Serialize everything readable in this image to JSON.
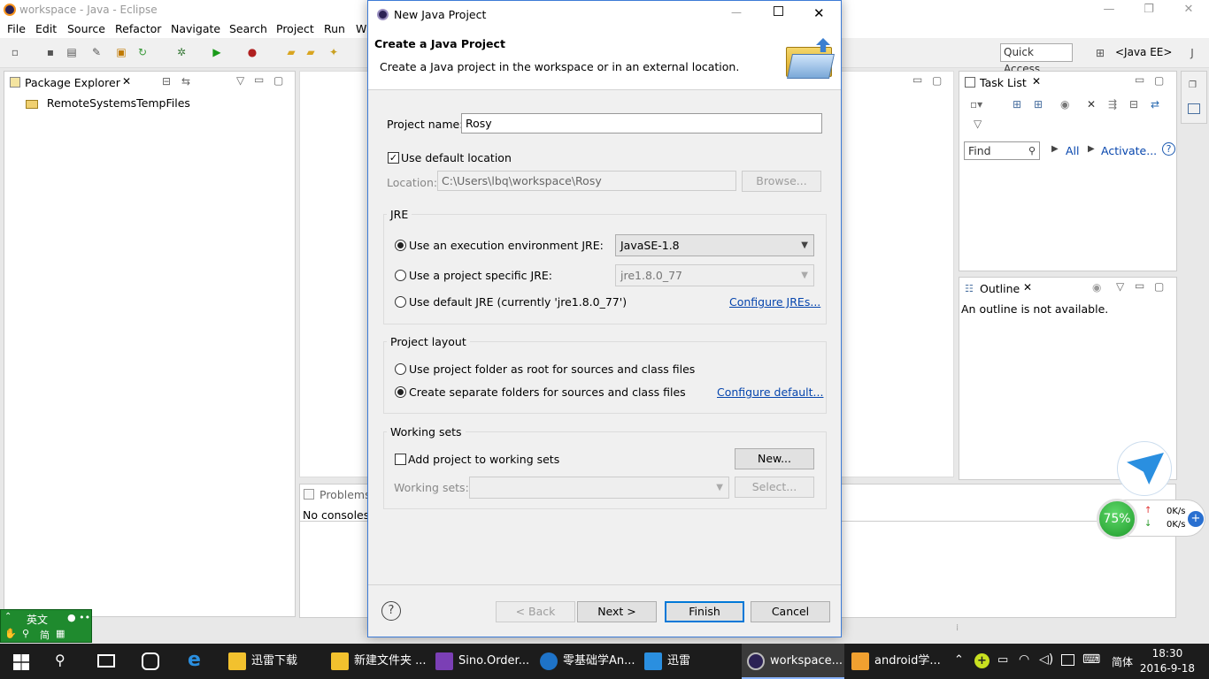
{
  "eclipse": {
    "window_title": "workspace - Java - Eclipse",
    "menu": [
      "File",
      "Edit",
      "Source",
      "Refactor",
      "Navigate",
      "Search",
      "Project",
      "Run",
      "W"
    ],
    "quick_access": "Quick Access",
    "perspective": "<Java EE>",
    "package_explorer": {
      "tab": "Package Explorer",
      "items": [
        "RemoteSystemsTempFiles"
      ]
    },
    "console": {
      "tab": "Problems",
      "message": "No consoles"
    },
    "task_list": {
      "tab": "Task List",
      "find_placeholder": "Find",
      "all": "All",
      "activate": "Activate..."
    },
    "outline": {
      "tab": "Outline",
      "message": "An outline is not available."
    }
  },
  "dialog": {
    "title": "New Java Project",
    "header_title": "Create a Java Project",
    "header_desc": "Create a Java project in the workspace or in an external location.",
    "project_name_label": "Project name:",
    "project_name_value": "Rosy",
    "use_default_location": "Use default location",
    "use_default_location_checked": true,
    "location_label": "Location:",
    "location_value": "C:\\Users\\lbq\\workspace\\Rosy",
    "browse": "Browse...",
    "jre": {
      "group": "JRE",
      "option_env": "Use an execution environment JRE:",
      "env_value": "JavaSE-1.8",
      "option_specific": "Use a project specific JRE:",
      "specific_value": "jre1.8.0_77",
      "option_default": "Use default JRE (currently 'jre1.8.0_77')",
      "configure_link": "Configure JREs...",
      "selected": "env"
    },
    "layout": {
      "group": "Project layout",
      "option_root": "Use project folder as root for sources and class files",
      "option_separate": "Create separate folders for sources and class files",
      "configure_link": "Configure default...",
      "selected": "separate"
    },
    "working_sets": {
      "group": "Working sets",
      "add_label": "Add project to working sets",
      "new_button": "New...",
      "sets_label": "Working sets:",
      "select_button": "Select..."
    },
    "buttons": {
      "help": "?",
      "back": "< Back",
      "next": "Next >",
      "finish": "Finish",
      "cancel": "Cancel"
    }
  },
  "ime": {
    "lang": "英文",
    "mode": "简"
  },
  "net_widget": {
    "percent": "75%",
    "up": "0K/s",
    "down": "0K/s"
  },
  "taskbar": {
    "apps": [
      {
        "label": "迅雷下载",
        "color": "#f2c12e"
      },
      {
        "label": "新建文件夹 ...",
        "color": "#f2c12e"
      },
      {
        "label": "Sino.Order...",
        "color": "#7b3fb5"
      },
      {
        "label": "零基础学An...",
        "color": "#1e73c8"
      },
      {
        "label": "迅雷",
        "color": "#2a8fe0"
      },
      {
        "label": "workspace...",
        "color": "#2c2255"
      },
      {
        "label": "android学...",
        "color": "#f0a030"
      }
    ],
    "ime_mode": "简体",
    "time": "18:30",
    "date": "2016-9-18"
  }
}
